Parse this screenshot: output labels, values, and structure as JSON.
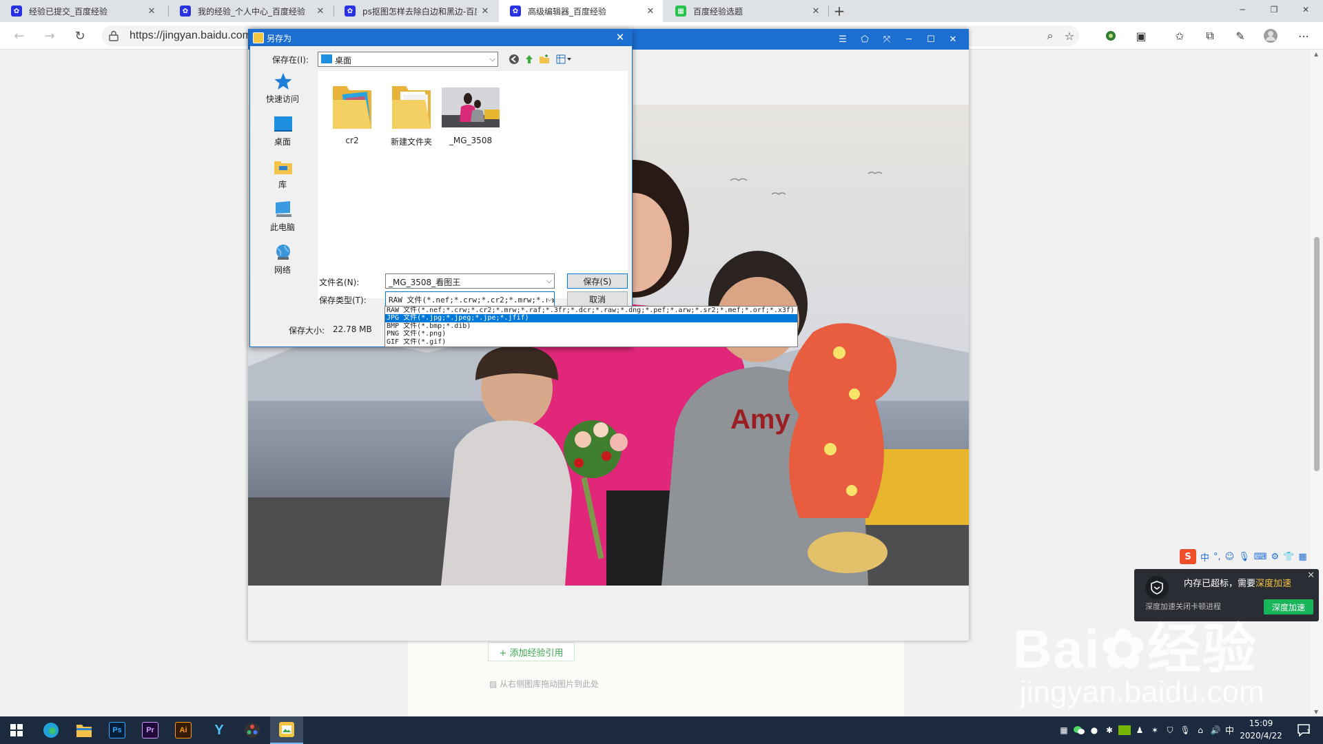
{
  "browser": {
    "tabs": [
      {
        "title": "经验已提交_百度经验",
        "favicon": "baidu-paw",
        "active": false
      },
      {
        "title": "我的经验_个人中心_百度经验",
        "favicon": "baidu-paw",
        "active": false
      },
      {
        "title": "ps抠图怎样去除白边和黑边-百度",
        "favicon": "baidu-paw",
        "active": false
      },
      {
        "title": "高级编辑器_百度经验",
        "favicon": "baidu-paw",
        "active": true
      },
      {
        "title": "百度经验选题",
        "favicon": "green-grid",
        "active": false
      }
    ],
    "new_tab": "+",
    "url": "https://jingyan.baidu.com"
  },
  "editor": {
    "add_ref_label": "+ 添加经验引用",
    "drag_hint": "从右侧图库拖动图片到此处"
  },
  "dialog": {
    "title": "另存为",
    "save_in_label": "保存在(I):",
    "save_in_value": "桌面",
    "places": [
      "快速访问",
      "桌面",
      "库",
      "此电脑",
      "网络"
    ],
    "files": [
      {
        "name": "cr2",
        "type": "folder-with-photo"
      },
      {
        "name": "新建文件夹",
        "type": "folder"
      },
      {
        "name": "_MG_3508",
        "type": "image"
      }
    ],
    "filename_label": "文件名(N):",
    "filename_value": "_MG_3508_看图王",
    "filetype_label": "保存类型(T):",
    "filetype_value": "RAW 文件(*.nef;*.crw;*.cr2;*.mrw;*.ra",
    "save_button": "保存(S)",
    "cancel_button": "取消",
    "size_label": "保存大小:",
    "size_value": "22.78 MB",
    "filetype_options": [
      "RAW 文件(*.nef;*.crw;*.cr2;*.mrw;*.raf;*.3fr;*.dcr;*.raw;*.dng;*.pef;*.arw;*.sr2;*.mef;*.orf;*.x3f)",
      "JPG 文件(*.jpg;*.jpeg;*.jpe;*.jfif)",
      "BMP 文件(*.bmp;*.dib)",
      "PNG 文件(*.png)",
      "GIF 文件(*.gif)"
    ],
    "selected_option_index": 1
  },
  "notification": {
    "message": "内存已超标，需要",
    "accent": "深度加速",
    "sub": "深度加速关闭卡顿进程",
    "button": "深度加速"
  },
  "ime": {
    "mode": "中"
  },
  "watermark": {
    "big": "Bai",
    "big_tail": "经验",
    "small": "jingyan.baidu.com"
  },
  "taskbar": {
    "apps": [
      {
        "name": "windows-start",
        "label": ""
      },
      {
        "name": "edge",
        "label": ""
      },
      {
        "name": "file-explorer",
        "label": ""
      },
      {
        "name": "photoshop",
        "label": "Ps"
      },
      {
        "name": "premiere",
        "label": "Pr"
      },
      {
        "name": "illustrator",
        "label": "Ai"
      },
      {
        "name": "app-y",
        "label": ""
      },
      {
        "name": "davinci",
        "label": ""
      },
      {
        "name": "image-viewer",
        "label": ""
      }
    ],
    "time": "15:09",
    "date": "2020/4/22",
    "ime": "中",
    "notification_count": "1"
  },
  "colors": {
    "accent": "#1c6fd0",
    "selection": "#0078d7",
    "taskbar": "#1b2a3f",
    "notify_button": "#18b55b"
  }
}
